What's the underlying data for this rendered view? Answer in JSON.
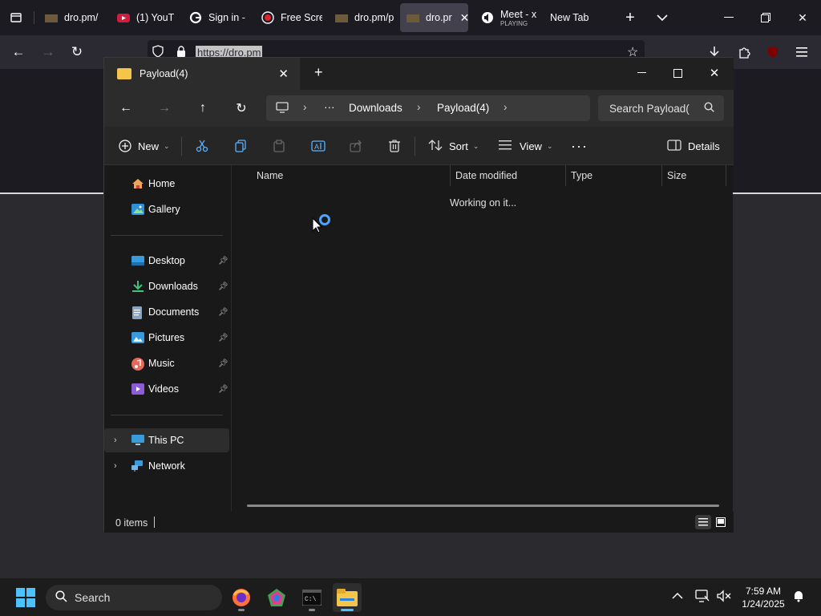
{
  "browser": {
    "tabs": [
      {
        "title": "dro.pm/",
        "active": false
      },
      {
        "title": "(1) YouT",
        "active": false
      },
      {
        "title": "Sign in -",
        "active": false
      },
      {
        "title": "Free Scre",
        "active": false
      },
      {
        "title": "dro.pm/p",
        "active": false
      },
      {
        "title": "dro.pr",
        "active": true
      },
      {
        "title": "Meet - x",
        "subtitle": "PLAYING",
        "active": false
      },
      {
        "title": "New Tab",
        "active": false
      }
    ],
    "url": "https://dro.pm"
  },
  "explorer": {
    "tab_title": "Payload(4)",
    "breadcrumb": {
      "more": "···",
      "items": [
        "Downloads",
        "Payload(4)"
      ]
    },
    "search_placeholder": "Search Payload(",
    "commands": {
      "new": "New",
      "sort": "Sort",
      "view": "View",
      "more": "···",
      "details": "Details"
    },
    "sidebar": {
      "top": [
        {
          "label": "Home",
          "icon": "home-icon"
        },
        {
          "label": "Gallery",
          "icon": "gallery-icon"
        }
      ],
      "pinned": [
        {
          "label": "Desktop",
          "icon": "desktop-icon"
        },
        {
          "label": "Downloads",
          "icon": "downloads-icon"
        },
        {
          "label": "Documents",
          "icon": "documents-icon"
        },
        {
          "label": "Pictures",
          "icon": "pictures-icon"
        },
        {
          "label": "Music",
          "icon": "music-icon"
        },
        {
          "label": "Videos",
          "icon": "videos-icon"
        }
      ],
      "locations": [
        {
          "label": "This PC",
          "icon": "this-pc-icon"
        },
        {
          "label": "Network",
          "icon": "network-icon"
        }
      ]
    },
    "columns": [
      "Name",
      "Date modified",
      "Type",
      "Size"
    ],
    "loading_text": "Working on it...",
    "status": "0 items"
  },
  "taskbar": {
    "search_placeholder": "Search",
    "time": "7:59 AM",
    "date": "1/24/2025"
  },
  "colors": {
    "accent": "#4cc2ff",
    "folder": "#f4c54b",
    "spinner": "#4ea3ff"
  }
}
